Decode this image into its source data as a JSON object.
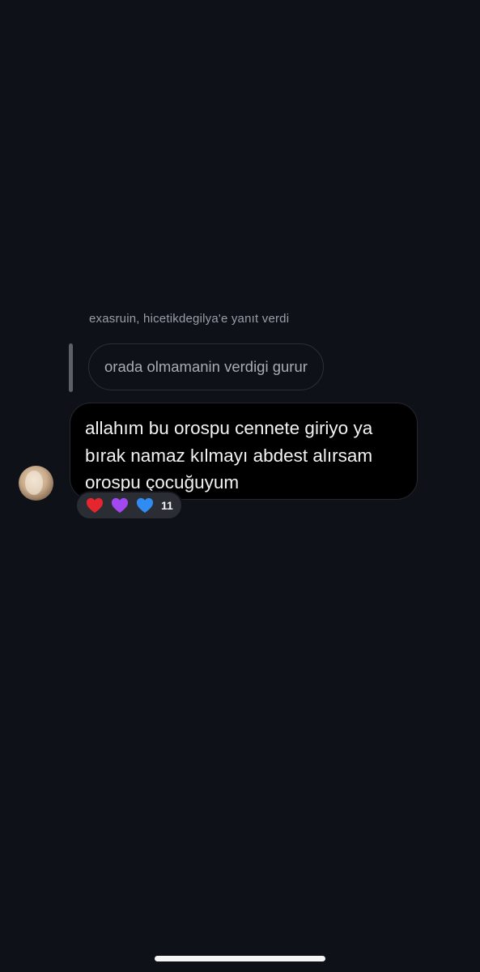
{
  "reply_header": "exasruin, hicetikdegilya'e yanıt verdi",
  "quoted_message": "orada olmamanin verdigi gurur",
  "message": {
    "lines": [
      "allahım bu orospu cennete giriyo ya",
      "bırak namaz kılmayı abdest alırsam",
      "orospu çocuğuyum"
    ]
  },
  "reactions": {
    "emojis": [
      {
        "icon": "red-heart-icon",
        "color": "#e6262e"
      },
      {
        "icon": "purple-heart-icon",
        "color": "#a347f0"
      },
      {
        "icon": "blue-heart-icon",
        "color": "#2f8cf2"
      }
    ],
    "count": "11"
  }
}
